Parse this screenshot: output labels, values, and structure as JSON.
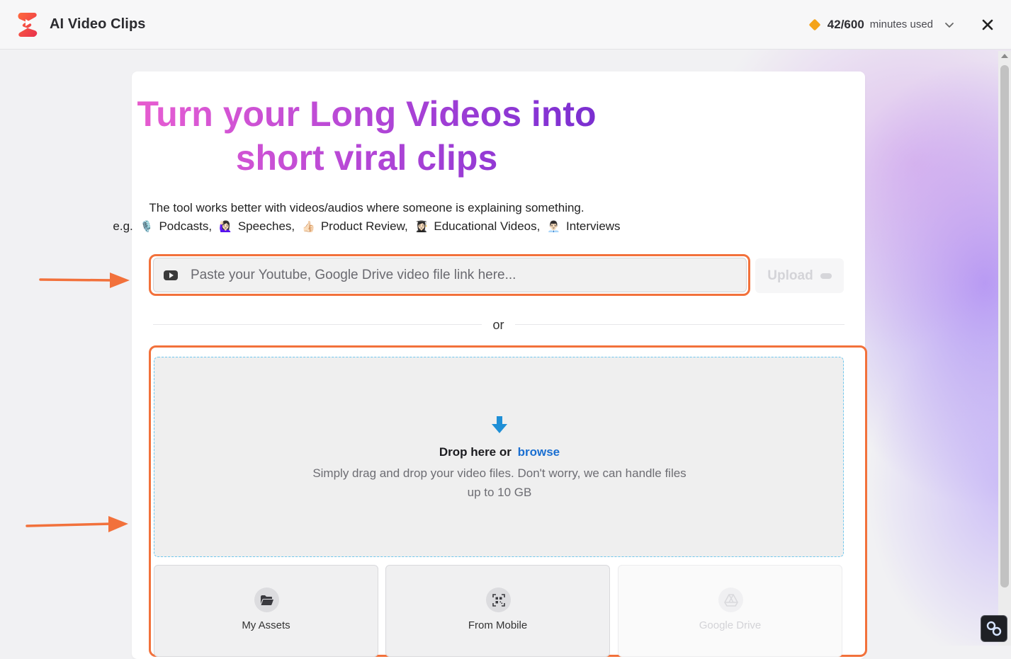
{
  "app": {
    "title": "AI Video Clips",
    "icon": "ai-video-clips-logo"
  },
  "usage": {
    "count": "42/600",
    "unit": "minutes used",
    "icon": "diamond-icon",
    "color": "#f4a31a"
  },
  "hero": {
    "title": "Turn your Long Videos into short viral clips",
    "subtitle": "The tool works better with videos/audios where someone is explaining something.",
    "examples_prefix": "e.g.",
    "examples": [
      {
        "icon": "🎙️",
        "label": "Podcasts,"
      },
      {
        "icon": "🙋🏻‍♀️",
        "label": "Speeches,"
      },
      {
        "icon": "👍🏻",
        "label": "Product Review,"
      },
      {
        "icon": "👩🏻‍🎓",
        "label": "Educational Videos,"
      },
      {
        "icon": "👨🏻‍💼",
        "label": "Interviews"
      }
    ]
  },
  "link_input": {
    "placeholder": "Paste your Youtube, Google Drive video file link here...",
    "value": "",
    "upload_label": "Upload"
  },
  "divider": {
    "label": "or"
  },
  "dropzone": {
    "title": "Drop here or",
    "browse_label": "browse",
    "description": "Simply drag and drop your video files. Don't worry, we can handle files up to 10 GB"
  },
  "sources": [
    {
      "label": "My Assets",
      "icon": "folder-icon",
      "enabled": true
    },
    {
      "label": "From Mobile",
      "icon": "qr-code-icon",
      "enabled": true
    },
    {
      "label": "Google Drive",
      "icon": "google-drive-icon",
      "enabled": false
    }
  ],
  "colors": {
    "annotation": "#f2713b",
    "gradient_start": "#ff5ea8",
    "gradient_end": "#5a22c8",
    "link": "#1a6fd1",
    "dropzone_border": "#6fc7ee"
  }
}
